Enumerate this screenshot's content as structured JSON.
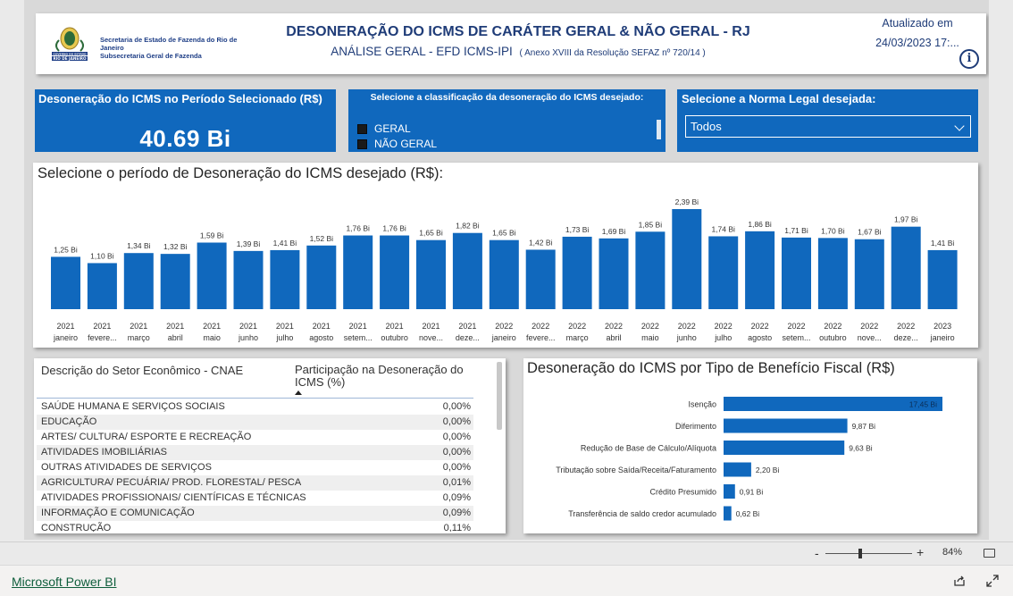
{
  "header": {
    "org_line1": "Secretaria de Estado de Fazenda do Rio de Janeiro",
    "org_line2": "Subsecretaria Geral de Fazenda",
    "crest_text": "GOVERNO DO ESTADO RIO DE JANEIRO",
    "title": "DESONERAÇÃO DO ICMS DE CARÁTER GERAL & NÃO GERAL - RJ",
    "subtitle": "ANÁLISE GERAL - EFD ICMS-IPI",
    "subtitle_note": "( Anexo XVIII da Resolução SEFAZ nº 720/14 )",
    "updated_label": "Atualizado em",
    "updated_value": "24/03/2023 17:...",
    "info_icon": "info-icon"
  },
  "kpi": {
    "label": "Desoneração do ICMS no Período Selecionado (R$)",
    "value": "40.69 Bi"
  },
  "classification_slicer": {
    "title": "Selecione a classificação da desoneração do ICMS desejado:",
    "options": [
      "GERAL",
      "NÃO GERAL"
    ]
  },
  "norma_slicer": {
    "title": "Selecione a Norma Legal desejada:",
    "selected": "Todos"
  },
  "chart_data": [
    {
      "type": "bar",
      "title": "Selecione o período de Desoneração do ICMS desejado (R$):",
      "color": "#1068bd",
      "categories": [
        [
          "2021",
          "janeiro"
        ],
        [
          "2021",
          "fevere..."
        ],
        [
          "2021",
          "março"
        ],
        [
          "2021",
          "abril"
        ],
        [
          "2021",
          "maio"
        ],
        [
          "2021",
          "junho"
        ],
        [
          "2021",
          "julho"
        ],
        [
          "2021",
          "agosto"
        ],
        [
          "2021",
          "setem..."
        ],
        [
          "2021",
          "outubro"
        ],
        [
          "2021",
          "nove..."
        ],
        [
          "2021",
          "deze..."
        ],
        [
          "2022",
          "janeiro"
        ],
        [
          "2022",
          "fevere..."
        ],
        [
          "2022",
          "março"
        ],
        [
          "2022",
          "abril"
        ],
        [
          "2022",
          "maio"
        ],
        [
          "2022",
          "junho"
        ],
        [
          "2022",
          "julho"
        ],
        [
          "2022",
          "agosto"
        ],
        [
          "2022",
          "setem..."
        ],
        [
          "2022",
          "outubro"
        ],
        [
          "2022",
          "nove..."
        ],
        [
          "2022",
          "deze..."
        ],
        [
          "2023",
          "janeiro"
        ]
      ],
      "values": [
        1.25,
        1.1,
        1.34,
        1.32,
        1.59,
        1.39,
        1.41,
        1.52,
        1.76,
        1.76,
        1.65,
        1.82,
        1.65,
        1.42,
        1.73,
        1.69,
        1.85,
        2.39,
        1.74,
        1.86,
        1.71,
        1.7,
        1.67,
        1.97,
        1.41
      ],
      "labels": [
        "1,25 Bi",
        "1,10 Bi",
        "1,34 Bi",
        "1,32 Bi",
        "1,59 Bi",
        "1,39 Bi",
        "1,41 Bi",
        "1,52 Bi",
        "1,76 Bi",
        "1,76 Bi",
        "1,65 Bi",
        "1,82 Bi",
        "1,65 Bi",
        "1,42 Bi",
        "1,73 Bi",
        "1,69 Bi",
        "1,85 Bi",
        "2,39 Bi",
        "1,74 Bi",
        "1,86 Bi",
        "1,71 Bi",
        "1,70 Bi",
        "1,67 Bi",
        "1,97 Bi",
        "1,41 Bi"
      ]
    },
    {
      "type": "bar",
      "orientation": "horizontal",
      "title": "Desoneração do ICMS por Tipo de Benefício Fiscal (R$)",
      "color": "#1068bd",
      "categories": [
        "Isenção",
        "Diferimento",
        "Redução de Base de Cálculo/Alíquota",
        "Tributação sobre Saída/Receita/Faturamento",
        "Crédito Presumido",
        "Transferência de saldo credor acumulado"
      ],
      "values": [
        17.45,
        9.87,
        9.63,
        2.2,
        0.91,
        0.62
      ],
      "labels": [
        "17,45 Bi",
        "9,87 Bi",
        "9,63 Bi",
        "2,20 Bi",
        "0,91 Bi",
        "0,62 Bi"
      ]
    }
  ],
  "table": {
    "col1_header": "Descrição do Setor Econômico - CNAE",
    "col2_header": "Participação na Desoneração do ICMS (%)",
    "rows": [
      [
        "SAÚDE HUMANA E SERVIÇOS SOCIAIS",
        "0,00%"
      ],
      [
        "EDUCAÇÃO",
        "0,00%"
      ],
      [
        "ARTES/ CULTURA/ ESPORTE E RECREAÇÃO",
        "0,00%"
      ],
      [
        "ATIVIDADES IMOBILIÁRIAS",
        "0,00%"
      ],
      [
        "OUTRAS ATIVIDADES DE SERVIÇOS",
        "0,00%"
      ],
      [
        "AGRICULTURA/ PECUÁRIA/ PROD. FLORESTAL/ PESCA",
        "0,01%"
      ],
      [
        "ATIVIDADES PROFISSIONAIS/ CIENTÍFICAS E TÉCNICAS",
        "0,09%"
      ],
      [
        "INFORMAÇÃO E COMUNICAÇÃO",
        "0,09%"
      ],
      [
        "CONSTRUÇÃO",
        "0,11%"
      ]
    ]
  },
  "status": {
    "zoom_minus": "-",
    "zoom_plus": "+",
    "zoom": "84%",
    "zoom_level": 0.84
  },
  "footer": {
    "brand": "Microsoft Power BI"
  }
}
